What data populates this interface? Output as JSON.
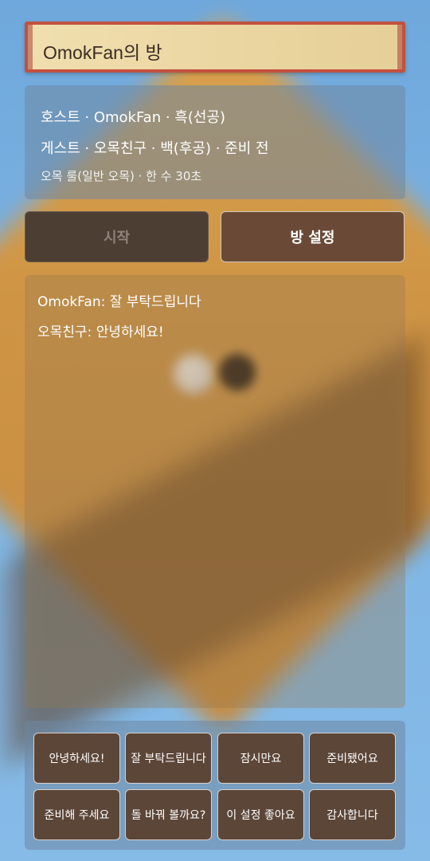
{
  "room": {
    "title": "OmokFan의 방"
  },
  "info": {
    "host_line": "호스트 · OmokFan · 흑(선공)",
    "guest_line": "게스트 · 오목친구 · 백(후공) · 준비 전",
    "rule_line": "오목 룰(일반 오목) · 한 수 30초"
  },
  "actions": {
    "start_label": "시작",
    "settings_label": "방 설정"
  },
  "chat": {
    "messages": [
      "OmokFan: 잘 부탁드립니다",
      "오목친구: 안녕하세요!"
    ]
  },
  "quick_chat": [
    "안녕하세요!",
    "잘 부탁드립니다",
    "잠시만요",
    "준비됐어요",
    "준비해 주세요",
    "돌 바꿔 볼까요?",
    "이 설정 좋아요",
    "감사합니다"
  ]
}
